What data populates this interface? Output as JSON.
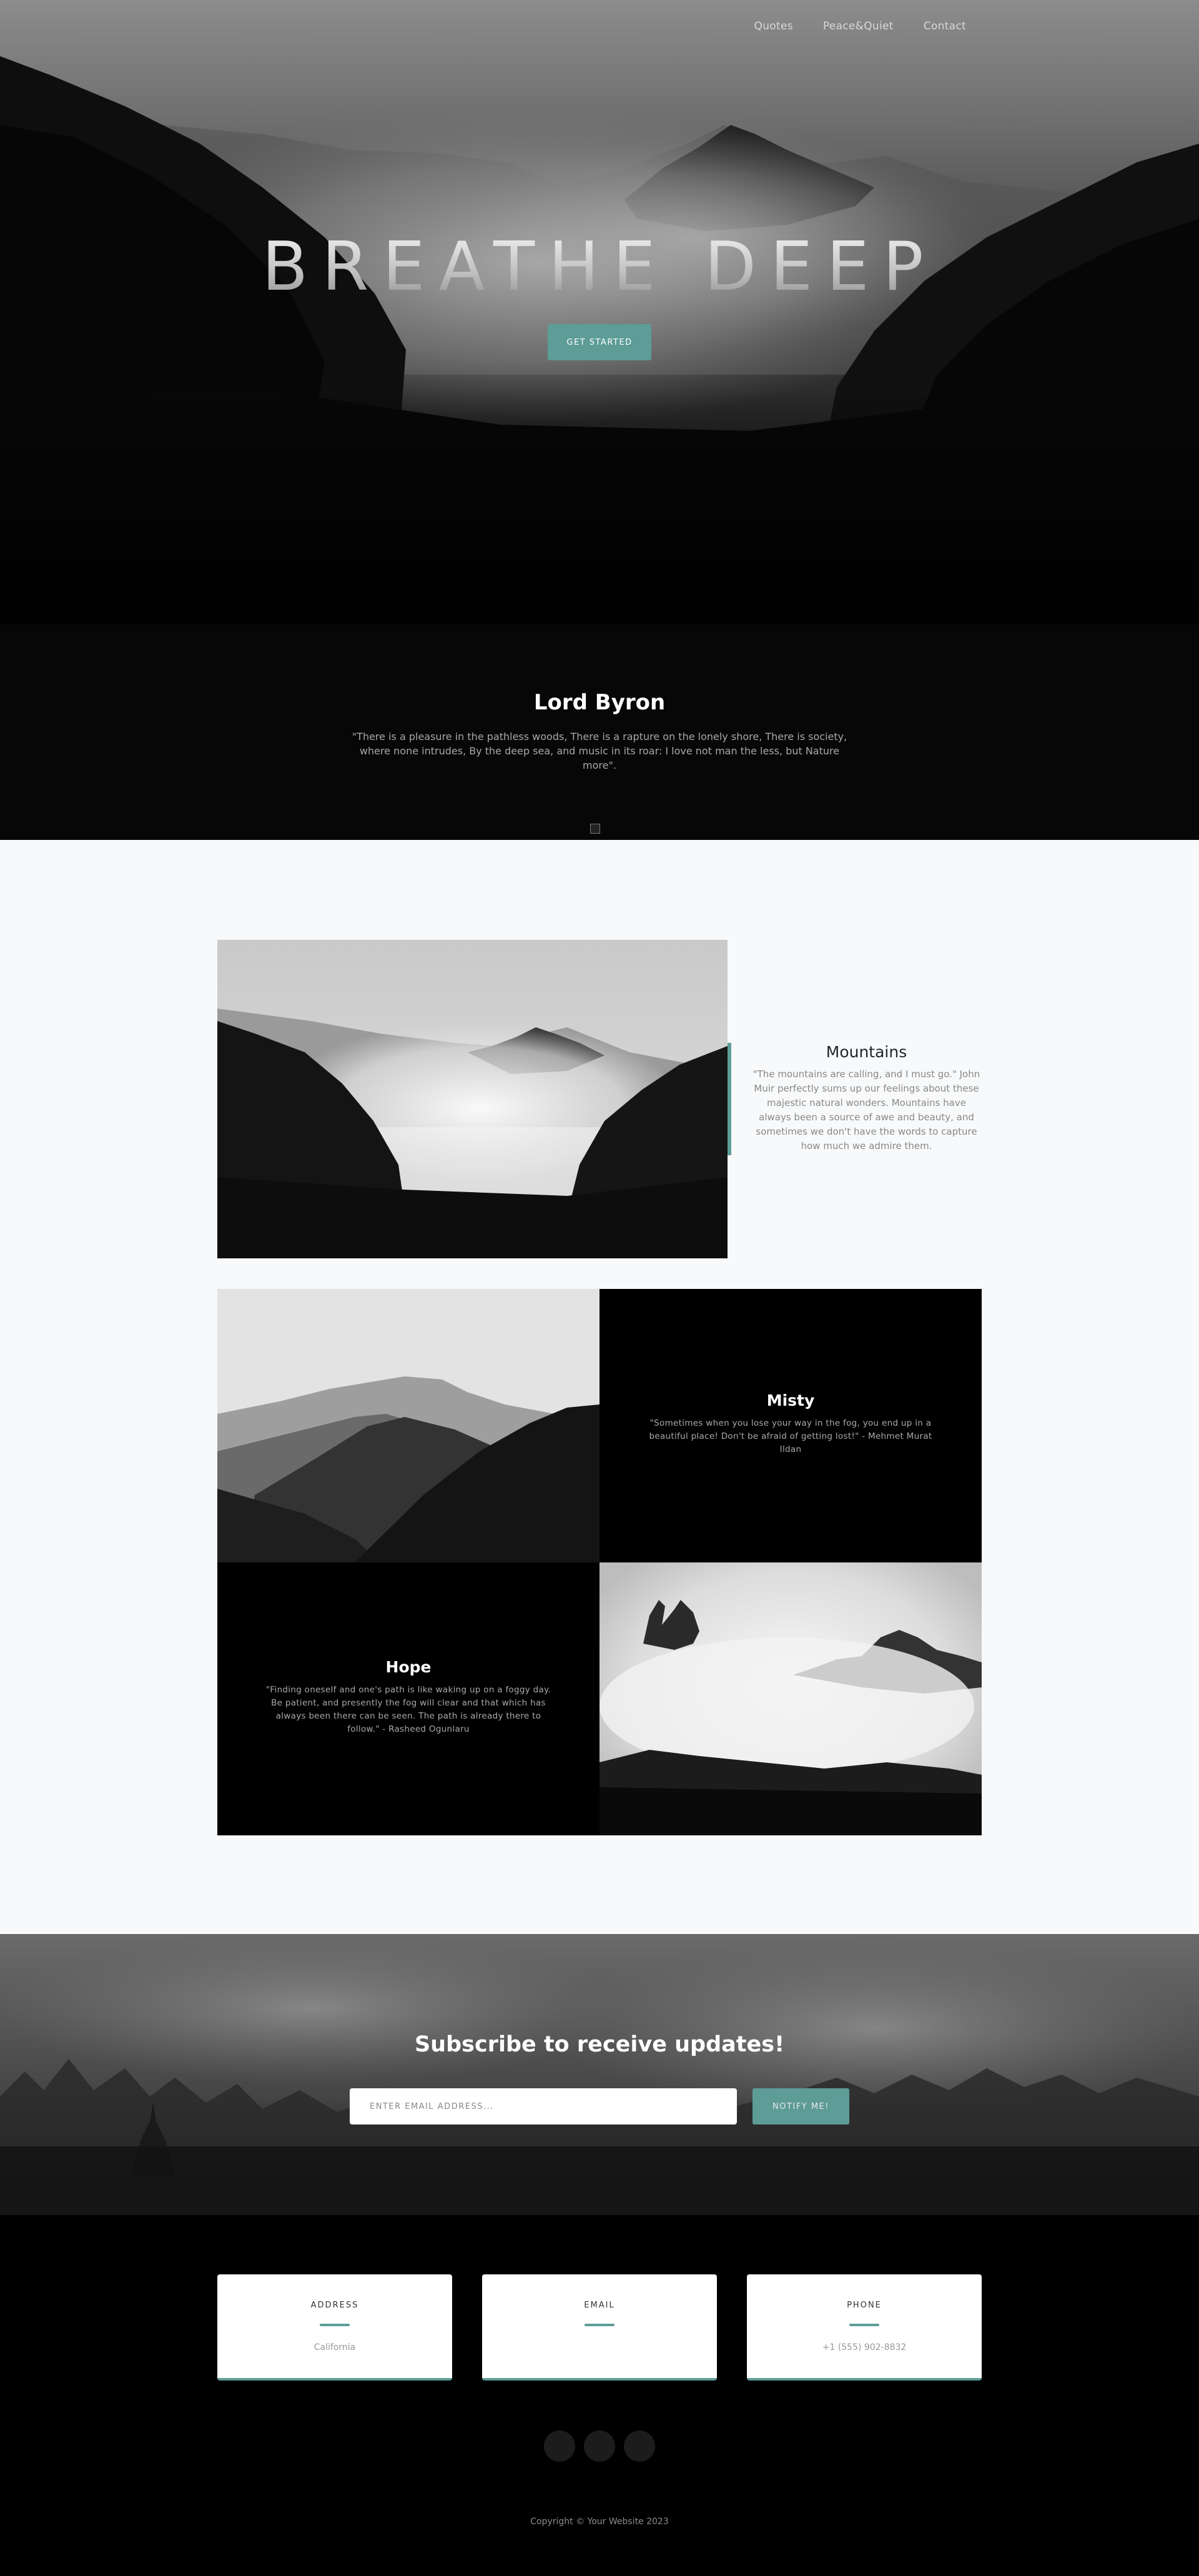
{
  "nav": {
    "items": [
      "Quotes",
      "Peace&Quiet",
      "Contact"
    ]
  },
  "hero": {
    "title": "BREATHE DEEP",
    "cta_label": "GET STARTED"
  },
  "byron": {
    "title": "Lord Byron",
    "quote": "\"There is a pleasure in the pathless woods, There is a rapture on the lonely shore, There is society, where none intrudes, By the deep sea, and music in its roar: I love not man the less, but Nature more\"."
  },
  "gallery": {
    "mountains": {
      "title": "Mountains",
      "text": "\"The mountains are calling, and I must go.\" John Muir perfectly sums up our feelings about these majestic natural wonders. Mountains have always been a source of awe and beauty, and sometimes we don't have the words to capture how much we admire them."
    },
    "misty": {
      "title": "Misty",
      "text": "\"Sometimes when you lose your way in the fog, you end up in a beautiful place! Don't be afraid of getting lost!\" - Mehmet Murat Ildan"
    },
    "hope": {
      "title": "Hope",
      "text": "\"Finding oneself and one's path is like waking up on a foggy day. Be patient, and presently the fog will clear and that which has always been there can be seen. The path is already there to follow.\" - Rasheed Ogunlaru"
    }
  },
  "subscribe": {
    "title": "Subscribe to receive updates!",
    "placeholder": "ENTER EMAIL ADDRESS...",
    "button_label": "NOTIFY ME!"
  },
  "contact": {
    "address": {
      "label": "ADDRESS",
      "value": "California"
    },
    "email": {
      "label": "EMAIL",
      "value": ""
    },
    "phone": {
      "label": "PHONE",
      "value": "+1 (555) 902-8832"
    }
  },
  "footer": {
    "copyright": "Copyright © Your Website 2023"
  },
  "colors": {
    "accent": "#5d9c97",
    "page_bg": "#f8f9fa",
    "dark": "#000000"
  }
}
